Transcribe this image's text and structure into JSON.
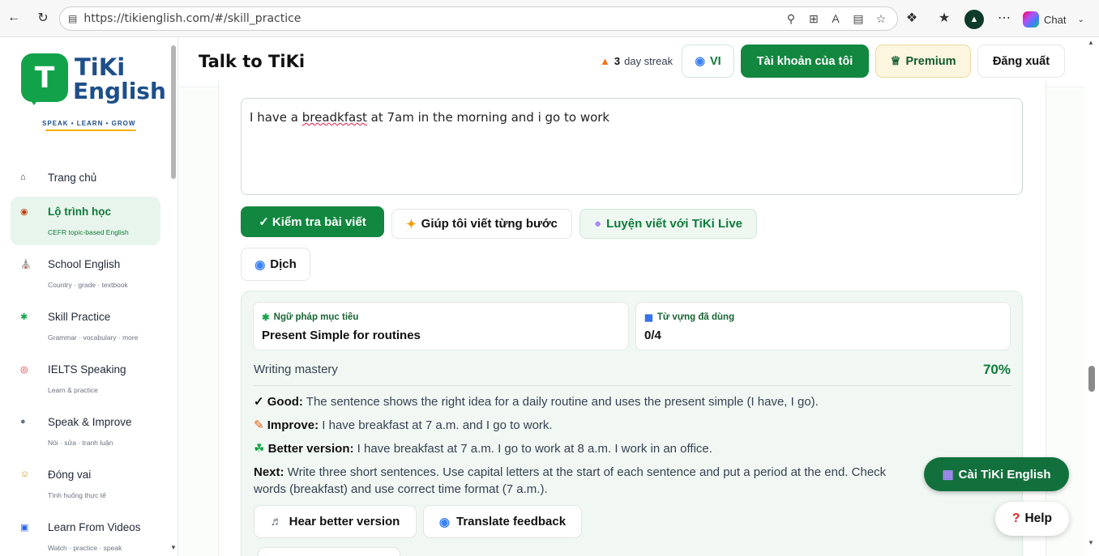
{
  "browser": {
    "url": "https://tikienglish.com/#/skill_practice",
    "chat_label": "Chat"
  },
  "sidebar": {
    "logo": {
      "line1": "TiKi",
      "line2": "English",
      "tagline": "SPEAK • LEARN • GROW"
    },
    "items": [
      {
        "icon": "home-icon",
        "label": "Trang chủ",
        "sub": ""
      },
      {
        "icon": "compass-icon",
        "label": "Lộ trình học",
        "sub": "CEFR topic-based English",
        "active": true
      },
      {
        "icon": "school-icon",
        "label": "School English",
        "sub": "Country · grade · textbook"
      },
      {
        "icon": "puzzle-icon",
        "label": "Skill Practice",
        "sub": "Grammar · vocabulary · more"
      },
      {
        "icon": "target-icon",
        "label": "IELTS Speaking",
        "sub": "Learn & practice"
      },
      {
        "icon": "mic-icon",
        "label": "Speak & Improve",
        "sub": "Nói · sửa · tranh luận"
      },
      {
        "icon": "theater-icon",
        "label": "Đóng vai",
        "sub": "Tình huống thực tế"
      },
      {
        "icon": "video-icon",
        "label": "Learn From Videos",
        "sub": "Watch · practice · speak"
      }
    ]
  },
  "header": {
    "title": "Talk to TiKi",
    "streak_count": "3",
    "streak_label": "day streak",
    "lang_label": "VI",
    "account_label": "Tài khoản của tôi",
    "premium_label": "Premium",
    "logout_label": "Đăng xuất"
  },
  "editor": {
    "text_before": "I have a ",
    "text_misspelled": "breadkfast",
    "text_after": " at 7am in the morning and i go to work"
  },
  "actions": {
    "check_label": "✓ Kiểm tra bài viết",
    "help_label": "Giúp tôi viết từng bước",
    "live_label": "Luyện viết với TiKi Live",
    "translate_label": "Dịch"
  },
  "feedback": {
    "grammar_title": "Ngữ pháp mục tiêu",
    "grammar_value": "Present Simple for routines",
    "vocab_title": "Từ vựng đã dùng",
    "vocab_value": "0/4",
    "mastery_label": "Writing mastery",
    "mastery_value": "70%",
    "good_label": "Good:",
    "good_text": " The sentence shows the right idea for a daily routine and uses the present simple (I have, I go).",
    "improve_label": "Improve:",
    "improve_text": " I have breakfast at 7 a.m. and I go to work.",
    "better_label": "Better version:",
    "better_text": " I have breakfast at 7 a.m. I go to work at 8 a.m. I work in an office.",
    "next_label": "Next:",
    "next_text": " Write three short sentences. Use capital letters at the start of each sentence and put a period at the end. Check",
    "next_text2": "words (breakfast) and use correct time format (7 a.m.).",
    "hear_label": "Hear better version",
    "translate_feedback_label": "Translate feedback"
  },
  "floating": {
    "install_label": "Cài TiKi English",
    "help_label": "Help"
  }
}
